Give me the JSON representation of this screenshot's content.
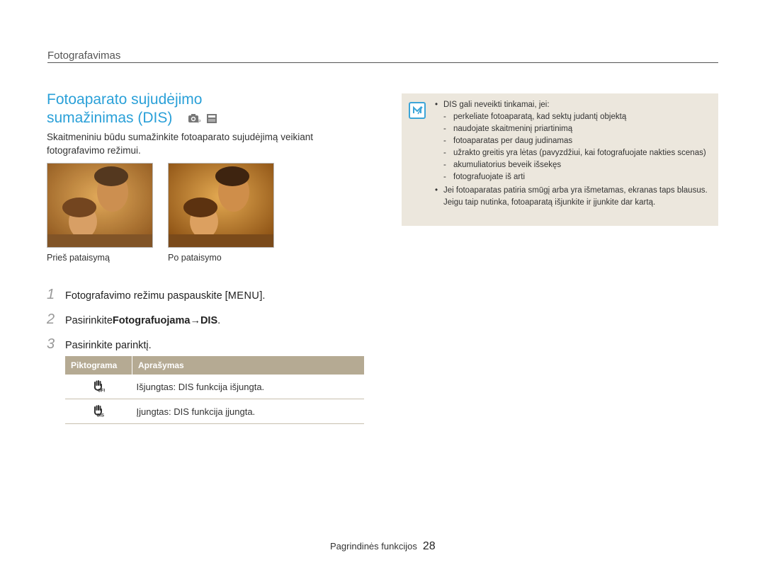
{
  "header": {
    "section": "Fotografavimas"
  },
  "title": {
    "line1": "Fotoaparato sujudėjimo",
    "line2": "sumažinimas (DIS)"
  },
  "mode_icons": [
    "camera-program-icon",
    "scene-icon"
  ],
  "intro": "Skaitmeniniu būdu sumažinkite fotoaparato sujudėjimą veikiant fotografavimo režimui.",
  "photos": [
    {
      "caption": "Prieš pataisymą"
    },
    {
      "caption": "Po pataisymo"
    }
  ],
  "steps": [
    {
      "num": "1",
      "pre": "Fotografavimo režimu paspauskite [",
      "bold": "MENU",
      "post": "]."
    },
    {
      "num": "2",
      "pre": "Pasirinkite ",
      "bold": "Fotografuojama",
      "arrow": " → ",
      "bold2": "DIS",
      "post": "."
    },
    {
      "num": "3",
      "pre": "Pasirinkite parinktį.",
      "bold": "",
      "post": ""
    }
  ],
  "table": {
    "headers": [
      "Piktograma",
      "Aprašymas"
    ],
    "rows": [
      {
        "icon": "dis-off-icon",
        "term": "Išjungtas",
        "desc": ": DIS funkcija išjungta."
      },
      {
        "icon": "dis-on-icon",
        "term": "Įjungtas",
        "desc": ": DIS funkcija įjungta."
      }
    ]
  },
  "note": {
    "icon": "note-icon",
    "bullet1": "DIS gali neveikti tinkamai, jei:",
    "items": [
      "perkeliate fotoaparatą, kad sektų judantį objektą",
      "naudojate skaitmeninį priartinimą",
      "fotoaparatas per daug judinamas",
      "užrakto greitis yra lėtas (pavyzdžiui, kai fotografuojate nakties scenas)",
      "akumuliatorius beveik išsekęs",
      "fotografuojate iš arti"
    ],
    "bullet2": "Jei fotoaparatas patiria smūgį arba yra išmetamas, ekranas taps blausus. Jeigu taip nutinka, fotoaparatą išjunkite ir įjunkite dar kartą."
  },
  "footer": {
    "label": "Pagrindinės funkcijos",
    "page": "28"
  },
  "colors": {
    "accent": "#2aa0d8",
    "table_header": "#b5aa93",
    "note_bg": "#ece7dd"
  }
}
